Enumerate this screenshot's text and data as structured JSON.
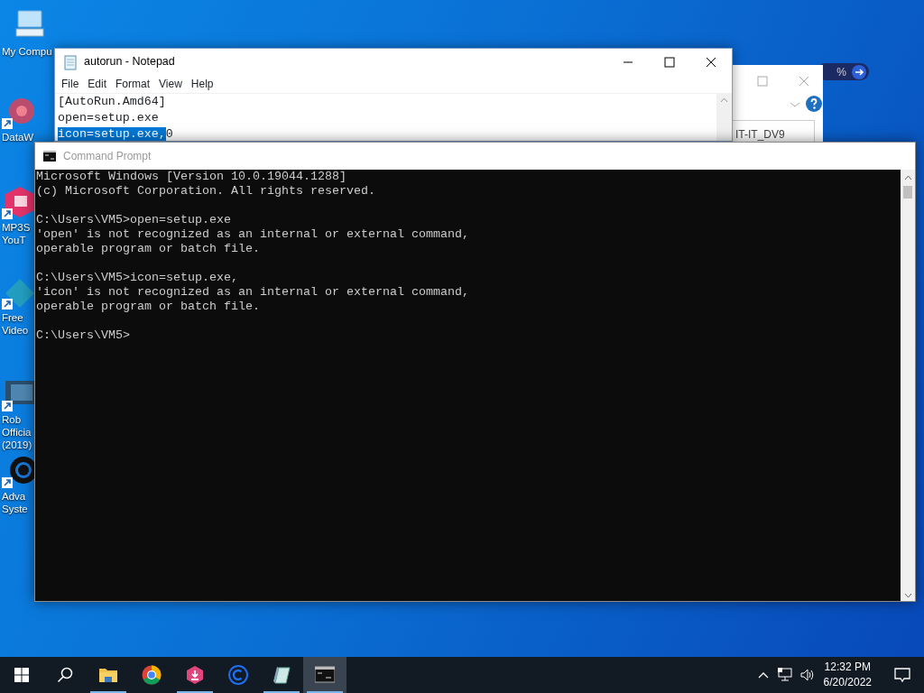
{
  "desktop_icons": [
    {
      "kind": "computer",
      "labels": [
        "My Compu"
      ]
    },
    {
      "kind": "datawrapper",
      "labels": [
        "DataW"
      ]
    },
    {
      "kind": "mp3",
      "labels": [
        "MP3S",
        "YouT"
      ]
    },
    {
      "kind": "video",
      "labels": [
        "Free",
        "Video"
      ]
    },
    {
      "kind": "film",
      "labels": [
        "Rob",
        "Officia",
        "(2019)"
      ]
    },
    {
      "kind": "ring",
      "labels": [
        "Adva",
        "Syste"
      ]
    }
  ],
  "background_widget": {
    "text": "%"
  },
  "background_window": {
    "field_text": "IT-IT_DV9"
  },
  "notepad": {
    "title": "autorun - Notepad",
    "menu": [
      "File",
      "Edit",
      "Format",
      "View",
      "Help"
    ],
    "lines": [
      [
        {
          "text": "[AutoRun.Amd64]",
          "selected": false
        }
      ],
      [
        {
          "text": "open=setup.exe",
          "selected": false
        }
      ],
      [
        {
          "text": "icon=setup.exe,",
          "selected": true
        },
        {
          "text": "0",
          "selected": false
        }
      ]
    ]
  },
  "command_prompt": {
    "title": "Command Prompt",
    "blocks": [
      [
        "Microsoft Windows [Version 10.0.19044.1288]",
        "(c) Microsoft Corporation. All rights reserved."
      ],
      [
        "C:\\Users\\VM5>open=setup.exe",
        "'open' is not recognized as an internal or external command,",
        "operable program or batch file."
      ],
      [
        "C:\\Users\\VM5>icon=setup.exe,",
        "'icon' is not recognized as an internal or external command,",
        "operable program or batch file."
      ],
      [
        "C:\\Users\\VM5>"
      ]
    ]
  },
  "taskbar": {
    "apps": [
      {
        "kind": "explorer",
        "running": true,
        "active": false
      },
      {
        "kind": "chrome",
        "running": false,
        "active": false
      },
      {
        "kind": "installer",
        "running": true,
        "active": false
      },
      {
        "kind": "ccleaner",
        "running": false,
        "active": false
      },
      {
        "kind": "notepad",
        "running": true,
        "active": false
      },
      {
        "kind": "cmd",
        "running": true,
        "active": true
      }
    ],
    "time": "12:32 PM",
    "date": "6/20/2022"
  }
}
